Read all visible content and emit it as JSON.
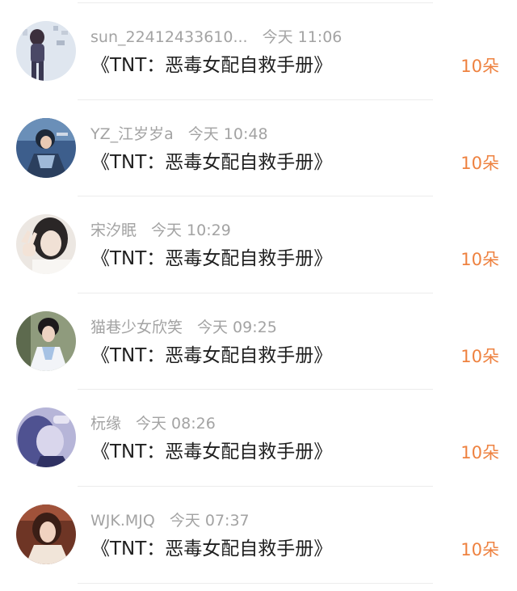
{
  "records": [
    {
      "username": "sun_22412433610...",
      "time": "今天 11:06",
      "title": "《TNT：恶毒女配自救手册》",
      "amount": "10朵",
      "avatar_icon": "avatar-woman-dark-outfit-icon",
      "avatar_colors": [
        "#dfe6ef",
        "#4a4866"
      ]
    },
    {
      "username": "YZ_江岁岁a",
      "time": "今天 10:48",
      "title": "《TNT：恶毒女配自救手册》",
      "amount": "10朵",
      "avatar_icon": "avatar-costume-blue-icon",
      "avatar_colors": [
        "#3d5e8c",
        "#1d2838"
      ]
    },
    {
      "username": "宋汐眠",
      "time": "今天 10:29",
      "title": "《TNT：恶毒女配自救手册》",
      "amount": "10朵",
      "avatar_icon": "avatar-girl-peace-sign-icon",
      "avatar_colors": [
        "#ece7e2",
        "#2a2626"
      ]
    },
    {
      "username": "猫巷少女欣笑",
      "time": "今天 09:25",
      "title": "《TNT：恶毒女配自救手册》",
      "amount": "10朵",
      "avatar_icon": "avatar-ancient-costume-icon",
      "avatar_colors": [
        "#8f9b7d",
        "#f2f4f8"
      ]
    },
    {
      "username": "杬缘",
      "time": "今天 08:26",
      "title": "《TNT：恶毒女配自救手册》",
      "amount": "10朵",
      "avatar_icon": "avatar-purple-portrait-icon",
      "avatar_colors": [
        "#b6b5d8",
        "#4f5291"
      ]
    },
    {
      "username": "WJK.MJQ",
      "time": "今天 07:37",
      "title": "《TNT：恶毒女配自救手册》",
      "amount": "10朵",
      "avatar_icon": "avatar-woman-warm-light-icon",
      "avatar_colors": [
        "#6e3525",
        "#f1e5d9"
      ]
    }
  ]
}
